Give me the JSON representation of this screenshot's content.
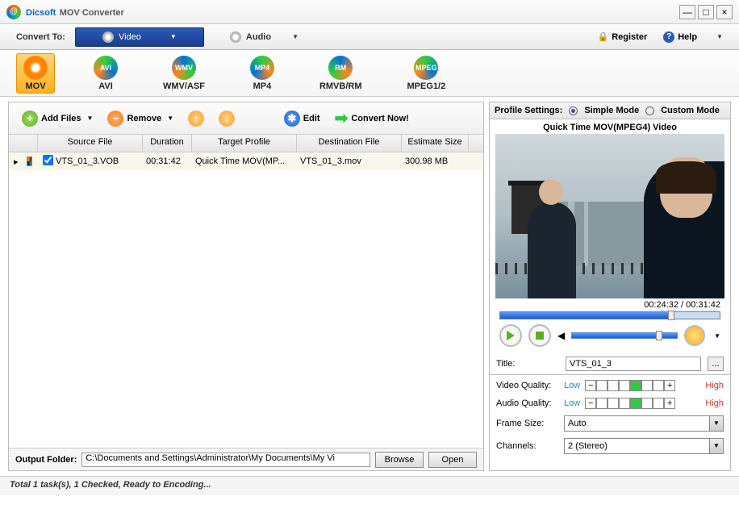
{
  "app": {
    "brand": "Dicsoft",
    "name": "MOV Converter"
  },
  "topbar": {
    "convert_to": "Convert To:",
    "video": "Video",
    "audio": "Audio",
    "register": "Register",
    "help": "Help"
  },
  "formats": [
    {
      "id": "mov",
      "label": "MOV",
      "active": true
    },
    {
      "id": "avi",
      "label": "AVI"
    },
    {
      "id": "wmv",
      "label": "WMV/ASF"
    },
    {
      "id": "mp4",
      "label": "MP4"
    },
    {
      "id": "rm",
      "label": "RMVB/RM"
    },
    {
      "id": "mpeg",
      "label": "MPEG1/2"
    }
  ],
  "toolbar": {
    "add": "Add Files",
    "remove": "Remove",
    "edit": "Edit",
    "convert": "Convert Now!"
  },
  "columns": {
    "source": "Source File",
    "duration": "Duration",
    "target": "Target Profile",
    "dest": "Destination File",
    "size": "Estimate Size"
  },
  "rows": [
    {
      "checked": true,
      "source": "VTS_01_3.VOB",
      "duration": "00:31:42",
      "target": "Quick Time MOV(MP...",
      "dest": "VTS_01_3.mov",
      "size": "300.98 MB"
    }
  ],
  "output": {
    "label": "Output Folder:",
    "path": "C:\\Documents and Settings\\Administrator\\My Documents\\My Vi",
    "browse": "Browse",
    "open": "Open"
  },
  "profile": {
    "header": "Profile Settings:",
    "simple": "Simple Mode",
    "custom": "Custom Mode",
    "title": "Quick Time MOV(MPEG4) Video"
  },
  "preview": {
    "time": "00:24:32 / 00:31:42"
  },
  "title_field": {
    "label": "Title:",
    "value": "VTS_01_3"
  },
  "settings": {
    "vq_label": "Video Quality:",
    "aq_label": "Audio Quality:",
    "low": "Low",
    "high": "High",
    "frame_label": "Frame Size:",
    "frame_value": "Auto",
    "channels_label": "Channels:",
    "channels_value": "2 (Stereo)"
  },
  "status": "Total 1 task(s), 1 Checked, Ready to Encoding..."
}
